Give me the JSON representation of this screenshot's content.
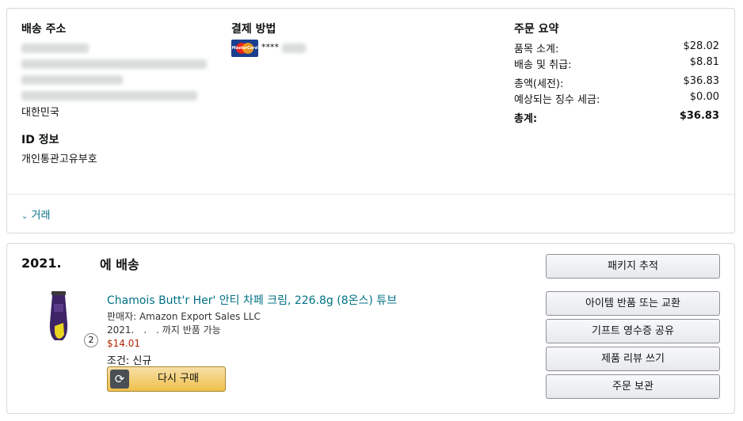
{
  "shipping": {
    "title": "배송 주소",
    "address_country": "대한민국"
  },
  "identity": {
    "title": "ID 정보",
    "value": "개인통관고유부호"
  },
  "payment": {
    "title": "결제 방법",
    "card_brand": "MasterCard",
    "card_mask": "****"
  },
  "order_summary": {
    "title": "주문 요약",
    "rows": [
      {
        "label": "품목 소계:",
        "value": "$28.02"
      },
      {
        "label": "배송 및 취급:",
        "value": "$8.81"
      },
      {
        "label": "총액(세전):",
        "value": "$36.83"
      },
      {
        "label": "예상되는 징수 세금:",
        "value": "$0.00"
      }
    ],
    "total": {
      "label": "총계:",
      "value": "$36.83"
    }
  },
  "transactions": {
    "toggle_label": "거래"
  },
  "shipment": {
    "year": "2021.",
    "delivered_label": "에 배송",
    "product": {
      "title": "Chamois Butt'r Her' 안티 차페 크림, 226.8g (8온스) 튜브",
      "seller": "판매자: Amazon Export Sales LLC",
      "return_window": "2021.　.　. 까지 반품 가능",
      "quantity": "2",
      "price": "$14.01",
      "condition": "조건: 신규",
      "buy_again_label": "다시 구매"
    },
    "actions": [
      "패키지 추적",
      "아이템 반품 또는 교환",
      "기프트 영수증 공유",
      "제품 리뷰 쓰기",
      "주문 보관"
    ]
  },
  "colors": {
    "link": "#007185",
    "price": "#b12704",
    "buy_button": "#f0c14b"
  }
}
